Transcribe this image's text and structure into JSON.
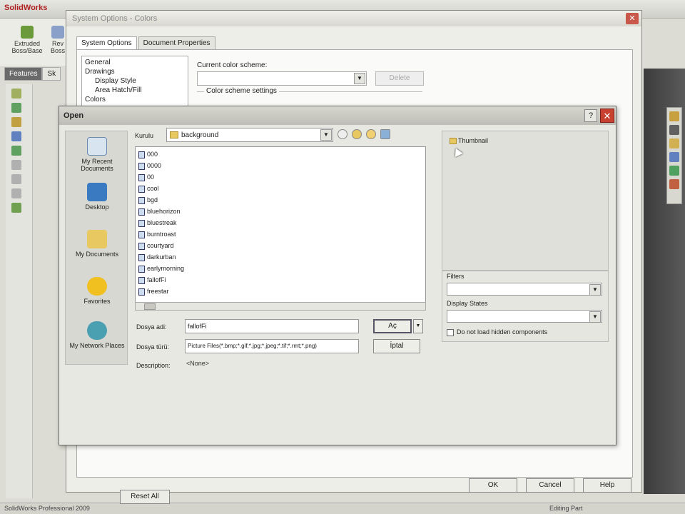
{
  "app": {
    "title": "SolidWorks",
    "status_left": "SolidWorks Professional 2009",
    "status_right": "Editing Part"
  },
  "ribbon": {
    "extruded_boss": "Extruded Boss/Base",
    "revolved": "Rev Boss"
  },
  "left_tabs": [
    "Features",
    "Sk"
  ],
  "system_options": {
    "title": "System Options - Colors",
    "tabs": [
      "System Options",
      "Document Properties"
    ],
    "tree": [
      "General",
      "Drawings",
      "Display Style",
      "Area Hatch/Fill",
      "Colors"
    ],
    "current_scheme_label": "Current color scheme:",
    "delete_label": "Delete",
    "scheme_settings_label": "Color scheme settings",
    "reset_all": "Reset All",
    "ok": "OK",
    "cancel": "Cancel",
    "help": "Help"
  },
  "open_dialog": {
    "title": "Open",
    "help": "?",
    "close": "✕",
    "places": [
      "My Recent Documents",
      "Desktop",
      "My Documents",
      "Favorites",
      "My Network Places"
    ],
    "lookin_label": "Kurulu",
    "lookin_value": "background",
    "files": [
      "000",
      "0000",
      "00",
      "cool",
      "bgd",
      "bluehorizon",
      "bluestreak",
      "burntroast",
      "courtyard",
      "darkurban",
      "earlymorning",
      "fallofFi",
      "freestar"
    ],
    "filename_label": "Dosya adi:",
    "filename_value": "fallofFi",
    "filetype_label": "Dosya türü:",
    "filetype_value": "Picture Files(*.bmp;*.gif;*.jpg;*.jpeg;*.tif;*.rmt;*.png)",
    "description_label": "Description:",
    "description_value": "<None>",
    "open_btn": "Aç",
    "cancel_btn": "İptal",
    "thumbnail_label": "Thumbnail",
    "filters_label": "Filters",
    "display_states_label": "Display States",
    "hidden_components_label": "Do not load hidden components"
  }
}
